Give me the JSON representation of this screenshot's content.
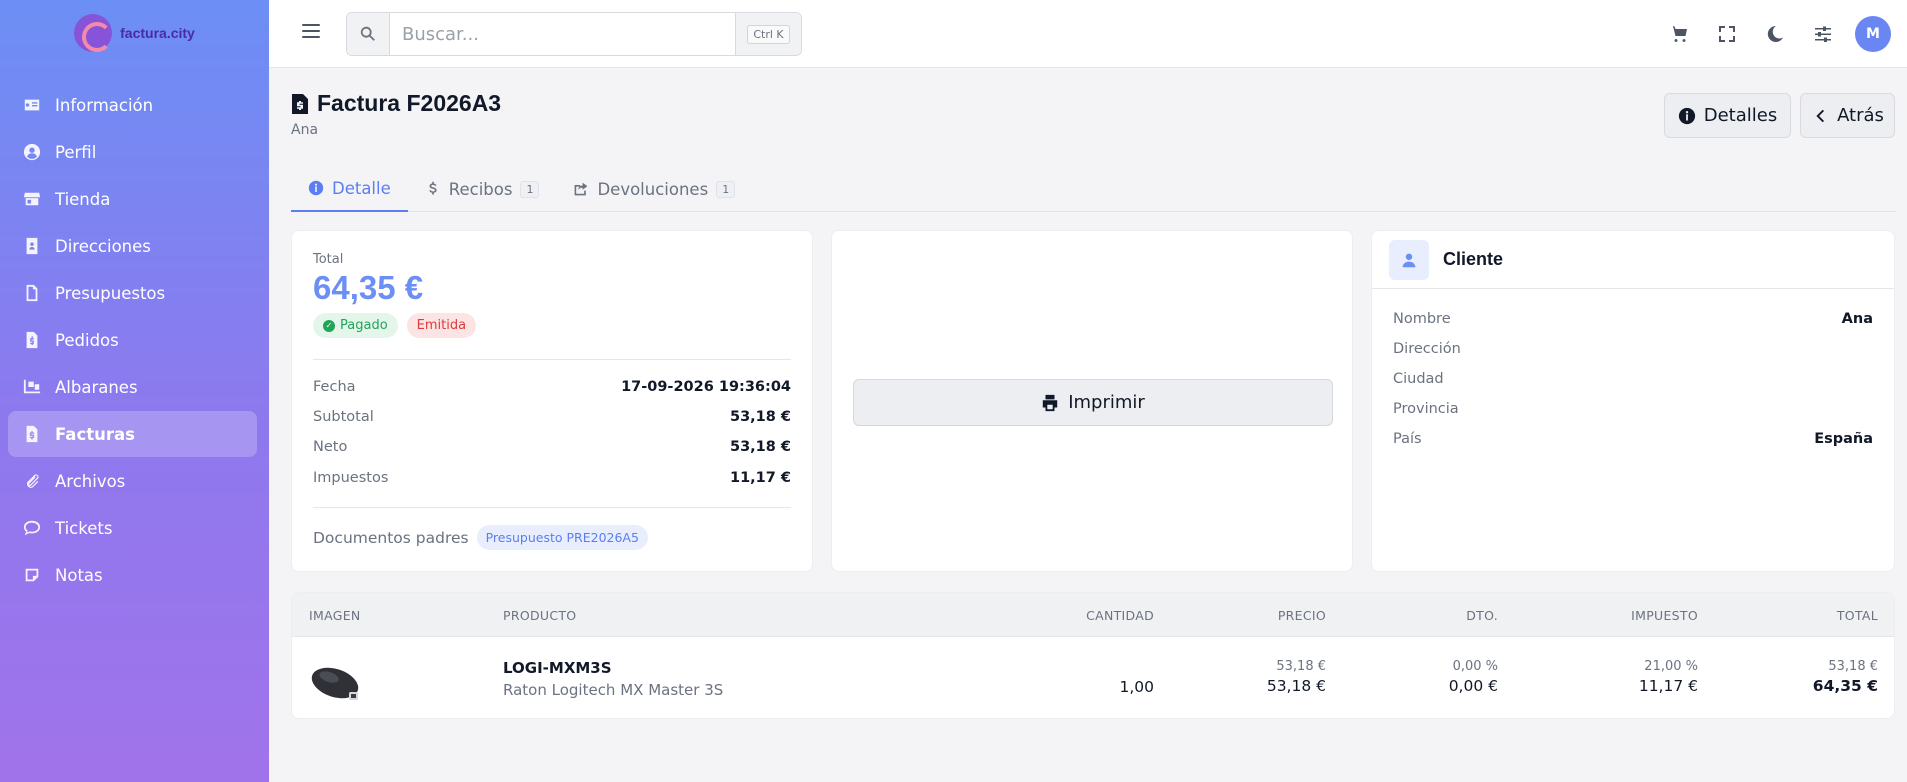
{
  "brand": {
    "name": "factura.city"
  },
  "sidebar": {
    "items": [
      {
        "label": "Información",
        "icon": "id-card-icon"
      },
      {
        "label": "Perfil",
        "icon": "user-circle-icon"
      },
      {
        "label": "Tienda",
        "icon": "store-icon"
      },
      {
        "label": "Direcciones",
        "icon": "address-book-icon"
      },
      {
        "label": "Presupuestos",
        "icon": "file-icon"
      },
      {
        "label": "Pedidos",
        "icon": "file-dollar-icon"
      },
      {
        "label": "Albaranes",
        "icon": "truck-loading-icon"
      },
      {
        "label": "Facturas",
        "icon": "file-invoice-icon",
        "active": true
      },
      {
        "label": "Archivos",
        "icon": "paperclip-icon"
      },
      {
        "label": "Tickets",
        "icon": "comment-icon"
      },
      {
        "label": "Notas",
        "icon": "note-icon"
      }
    ]
  },
  "topbar": {
    "search_placeholder": "Buscar...",
    "search_shortcut": "Ctrl K",
    "avatar_initial": "M"
  },
  "header": {
    "title": "Factura F2026A3",
    "subtitle": "Ana",
    "details_button": "Detalles",
    "back_button": "Atrás"
  },
  "tabs": [
    {
      "label": "Detalle",
      "count": "",
      "active": true
    },
    {
      "label": "Recibos",
      "count": "1"
    },
    {
      "label": "Devoluciones",
      "count": "1"
    }
  ],
  "summary": {
    "total_label": "Total",
    "total_value": "64,35 €",
    "status_paid": "Pagado",
    "status_issued": "Emitida",
    "rows": [
      {
        "k": "Fecha",
        "v": "17-09-2026 19:36:04"
      },
      {
        "k": "Subtotal",
        "v": "53,18 €"
      },
      {
        "k": "Neto",
        "v": "53,18 €"
      },
      {
        "k": "Impuestos",
        "v": "11,17 €"
      }
    ],
    "parents_label": "Documentos padres",
    "parent_chip": "Presupuesto PRE2026A5"
  },
  "print": {
    "label": "Imprimir"
  },
  "client": {
    "title": "Cliente",
    "rows": [
      {
        "k": "Nombre",
        "v": "Ana"
      },
      {
        "k": "Dirección",
        "v": ""
      },
      {
        "k": "Ciudad",
        "v": ""
      },
      {
        "k": "Provincia",
        "v": ""
      },
      {
        "k": "País",
        "v": "España"
      }
    ]
  },
  "lines": {
    "headers": {
      "image": "IMAGEN",
      "product": "PRODUCTO",
      "quantity": "CANTIDAD",
      "price": "PRECIO",
      "discount": "DTO.",
      "tax": "IMPUESTO",
      "total": "TOTAL"
    },
    "rows": [
      {
        "code": "LOGI-MXM3S",
        "name": "Raton Logitech MX Master 3S",
        "quantity": "1,00",
        "price_unit": "53,18 €",
        "price": "53,18 €",
        "discount_pct": "0,00 %",
        "discount": "0,00 €",
        "tax_pct": "21,00 %",
        "tax": "11,17 €",
        "total_base": "53,18 €",
        "total": "64,35 €"
      }
    ]
  },
  "colors": {
    "accent": "#6c8ff5",
    "paid": "#22a35a",
    "issued": "#dc3b3b"
  }
}
